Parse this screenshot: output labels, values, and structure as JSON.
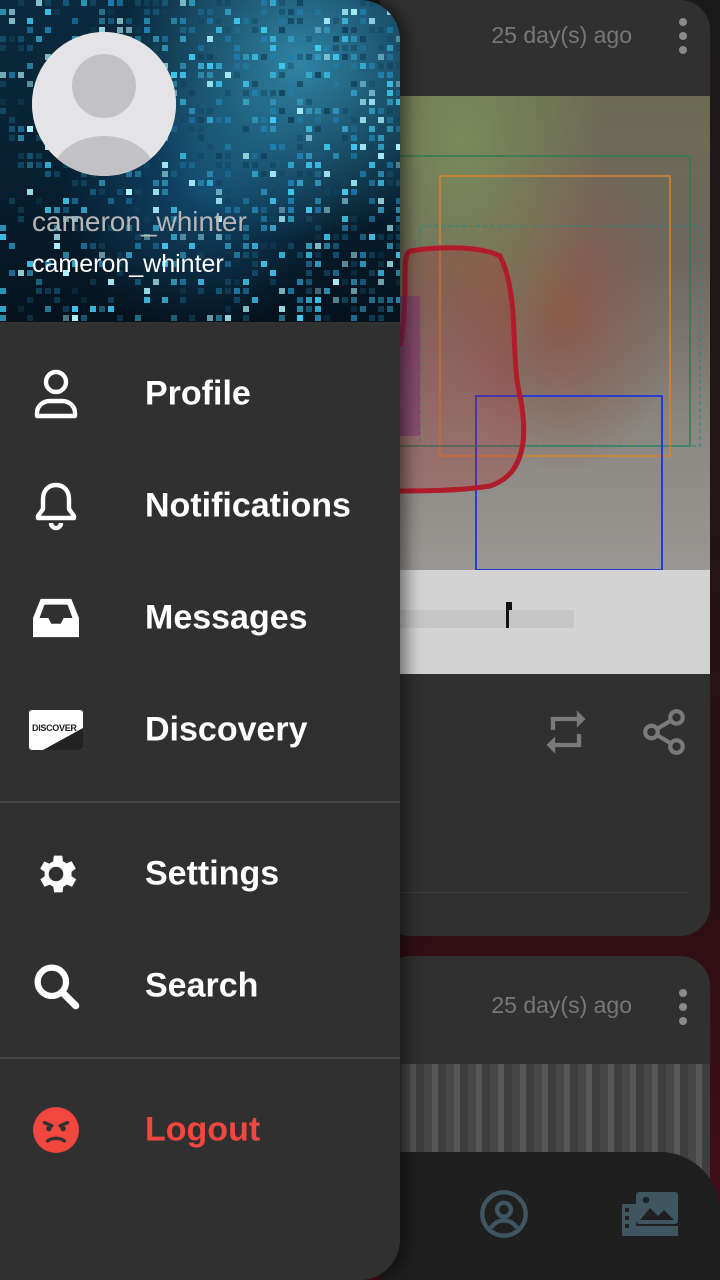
{
  "drawer": {
    "username_primary": "cameron_whinter",
    "username_secondary": "cameron_whinter",
    "items": [
      {
        "label": "Profile",
        "icon": "user-outline-icon"
      },
      {
        "label": "Notifications",
        "icon": "bell-icon"
      },
      {
        "label": "Messages",
        "icon": "inbox-icon"
      },
      {
        "label": "Discovery",
        "icon": "discover-card-icon"
      },
      {
        "label": "Settings",
        "icon": "gear-icon"
      },
      {
        "label": "Search",
        "icon": "search-icon"
      },
      {
        "label": "Logout",
        "icon": "angry-face-icon"
      }
    ],
    "discover_card_text": "DISCOVER",
    "logout_color": "#f2473f"
  },
  "feed": {
    "posts": [
      {
        "time": "25 day(s) ago"
      },
      {
        "time": "25 day(s) ago"
      }
    ]
  },
  "colors": {
    "drawer_bg": "#303030",
    "header_accent": "#50d2ff",
    "logout_red": "#f2473f"
  }
}
